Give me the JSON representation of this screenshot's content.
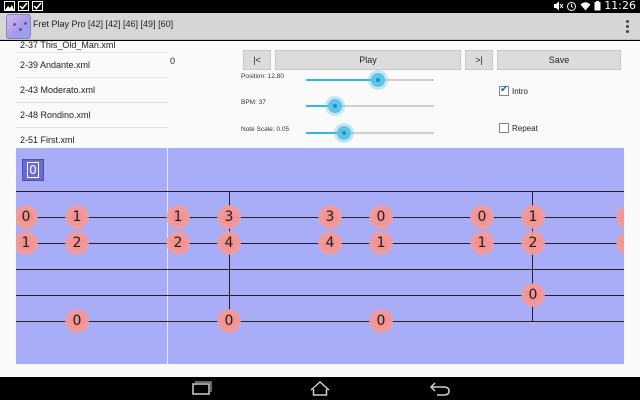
{
  "status_bar": {
    "time": "11:26",
    "icons": [
      "image-icon",
      "checkbox-icon",
      "checkbox-icon",
      "mute-icon",
      "alarm-icon",
      "wifi-icon",
      "battery-icon"
    ]
  },
  "app": {
    "title": "Fret Play Pro [42] [42] [46] [49] [60]"
  },
  "file_list": [
    "2-37 This_Old_Man.xml",
    "2-39 Andante.xml",
    "2-43 Moderato.xml",
    "2-48 Rondino.xml",
    "2-51 First.xml"
  ],
  "controls": {
    "position_value": "0",
    "rewind_label": "|<",
    "play_label": "Play",
    "forward_label": ">|",
    "save_label": "Save",
    "position_label": "Position: 12.80",
    "position_fraction": 0.56,
    "bpm_label": "BPM: 37",
    "bpm_fraction": 0.23,
    "note_scale_label": "Note Scale: 0.05",
    "note_scale_fraction": 0.3,
    "intro_label": "Intro",
    "intro_checked": true,
    "repeat_label": "Repeat",
    "repeat_checked": false
  },
  "fretboard": {
    "fret_indicator": "0",
    "colors": {
      "board": "#a9acf6",
      "note": "#f29a9a",
      "slider": "#33b5e5"
    },
    "notes_row1": [
      "0",
      "1",
      "1",
      "3",
      "3",
      "0",
      "0",
      "1"
    ],
    "notes_row2": [
      "1",
      "2",
      "2",
      "4",
      "4",
      "1",
      "1",
      "2"
    ],
    "notes_row4": [
      "0"
    ],
    "notes_row5": [
      "0",
      "0",
      "0"
    ]
  },
  "nav_bar": {
    "icons": [
      "back-icon",
      "home-icon",
      "recents-icon"
    ]
  }
}
